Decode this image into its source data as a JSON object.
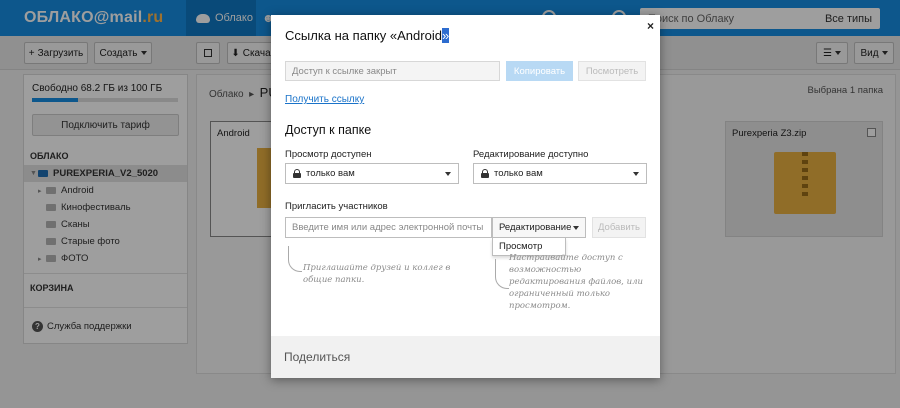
{
  "header": {
    "logo_text": "ОБЛАКО@mail",
    "logo_tld": ".ru",
    "nav_cloud": "Облако",
    "search_placeholder": "Поиск по Облаку",
    "search_types": "Все типы"
  },
  "toolbar": {
    "upload_label": "Загрузить",
    "create_label": "Создать",
    "download_label": "Скача",
    "view_label": "Вид"
  },
  "sidebar": {
    "quota_text": "Свободно 68.2 ГБ из 100 ГБ",
    "quota_fraction": 0.318,
    "tarif_button": "Подключить тариф",
    "cloud_heading": "ОБЛАКО",
    "tree": [
      {
        "label": "PUREXPERIA_V2_5020",
        "selected": true
      },
      {
        "label": "Android"
      },
      {
        "label": "Кинофестиваль"
      },
      {
        "label": "Сканы"
      },
      {
        "label": "Старые фото"
      },
      {
        "label": "ФОТО"
      }
    ],
    "trash_heading": "КОРЗИНА",
    "support_label": "Служба поддержки"
  },
  "content": {
    "breadcrumb_root": "Облако",
    "breadcrumb_current": "PU",
    "selected_count": "Выбрана 1 папка",
    "tiles": [
      {
        "name": "Android"
      },
      {
        "name": "Purexperia Z3.zip"
      }
    ]
  },
  "modal": {
    "title_prefix": "Ссылка на папку «Android",
    "title_suffix": "»",
    "close": "×",
    "link_input_placeholder": "Доступ к ссылке закрыт",
    "copy_button": "Копировать",
    "view_button": "Посмотреть",
    "get_link": "Получить ссылку",
    "access_title": "Доступ к папке",
    "view_access_label": "Просмотр доступен",
    "edit_access_label": "Редактирование доступно",
    "view_access_value": "только вам",
    "edit_access_value": "только вам",
    "invite_label": "Пригласить участников",
    "invite_placeholder": "Введите имя или адрес электронной почты",
    "role_selected": "Редактирование",
    "role_option": "Просмотр",
    "add_button": "Добавить",
    "hint_left": "Приглашайте друзей и коллег в общие папки.",
    "hint_right": "Настраивайте доступ с возможностью редактирования файлов, или ограниченный только просмотром.",
    "footer_share": "Поделиться"
  }
}
